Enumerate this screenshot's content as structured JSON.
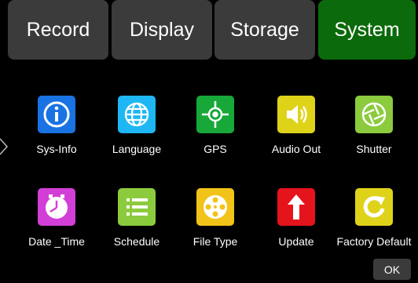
{
  "tabs": [
    {
      "label": "Record"
    },
    {
      "label": "Display"
    },
    {
      "label": "Storage"
    },
    {
      "label": "System"
    }
  ],
  "active_tab": "System",
  "grid": {
    "row1": [
      {
        "label": "Sys-Info",
        "icon": "info-icon",
        "color": "#1973e3"
      },
      {
        "label": "Language",
        "icon": "globe-icon",
        "color": "#1fb7f3"
      },
      {
        "label": "GPS",
        "icon": "gps-crosshair-icon",
        "color": "#18a83a"
      },
      {
        "label": "Audio Out",
        "icon": "speaker-icon",
        "color": "#dfd31a"
      },
      {
        "label": "Shutter",
        "icon": "aperture-icon",
        "color": "#8ccb3e"
      }
    ],
    "row2": [
      {
        "label": "Date _Time",
        "icon": "clock-icon",
        "color": "#d23fd6"
      },
      {
        "label": "Schedule",
        "icon": "list-icon",
        "color": "#8ccb3e"
      },
      {
        "label": "File Type",
        "icon": "film-reel-icon",
        "color": "#f2c318"
      },
      {
        "label": "Update",
        "icon": "upload-arrow-icon",
        "color": "#e5131b"
      },
      {
        "label": "Factory Default",
        "icon": "reset-icon",
        "color": "#dfd31a"
      }
    ]
  },
  "ok_label": "OK"
}
